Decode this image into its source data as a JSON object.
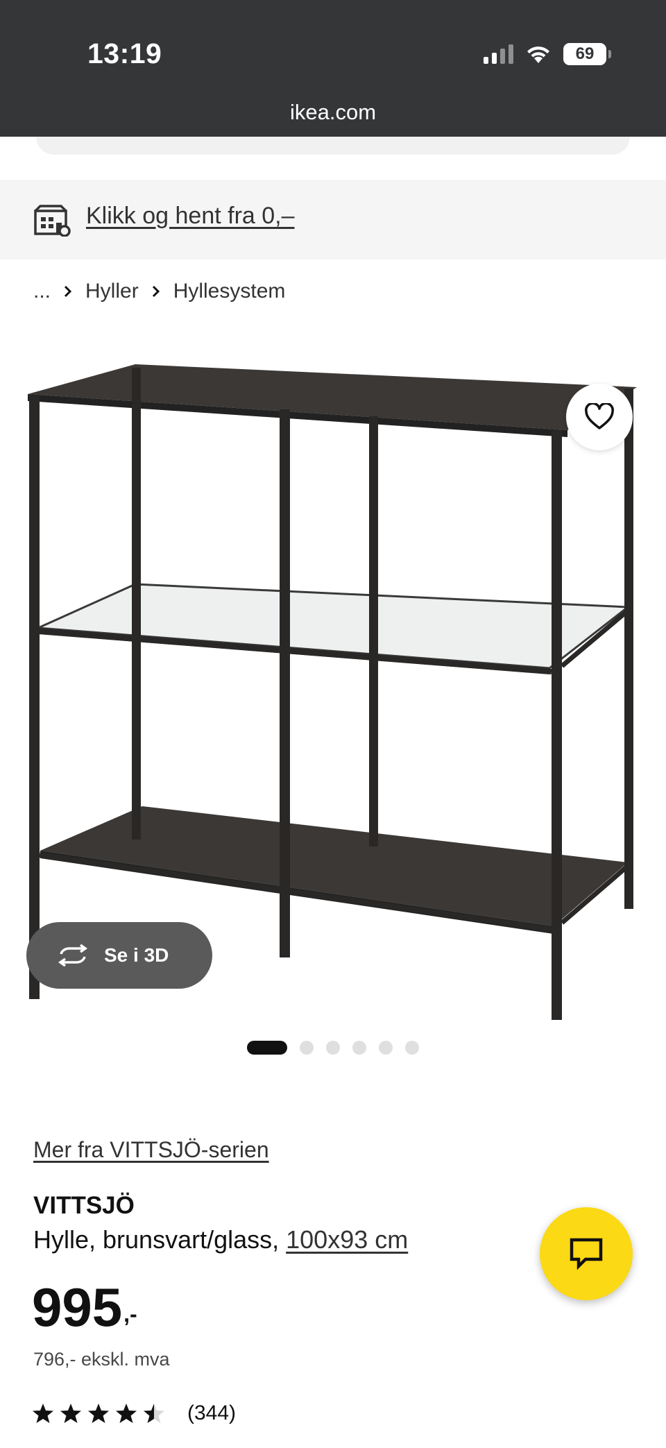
{
  "status_bar": {
    "time": "13:19",
    "battery": "69",
    "icons": [
      "cellular-signal-icon",
      "wifi-icon",
      "battery-icon"
    ]
  },
  "browser": {
    "url": "ikea.com"
  },
  "promo": {
    "icon": "store-pickup-icon",
    "link_text": "Klikk og hent fra 0,–"
  },
  "breadcrumb": {
    "ellipsis": "...",
    "items": [
      "Hyller",
      "Hyllesystem"
    ],
    "separator_icon": "chevron-right-icon"
  },
  "gallery": {
    "favorite_icon": "heart-icon",
    "view_3d_label": "Se i 3D",
    "view_3d_icon": "rotate-icon",
    "image_count": 6,
    "active_image": 1
  },
  "product": {
    "series_link": "Mer fra VITTSJÖ-serien",
    "name": "VITTSJÖ",
    "description_prefix": "Hylle, brunsvart/glass, ",
    "size_link": "100x93 cm",
    "price_integer": "995",
    "price_suffix": ",-",
    "price_ex_vat": "796,- ekskl. mva",
    "rating": 4.5,
    "rating_max": 5,
    "review_count": "(344)"
  },
  "chat": {
    "icon": "chat-bubble-icon"
  },
  "colors": {
    "status_bar_bg": "#343638",
    "promo_bg": "#f5f5f5",
    "chat_yellow": "#fbd914",
    "text_dark": "#111111",
    "button_3d_bg": "#5a5a5a"
  }
}
